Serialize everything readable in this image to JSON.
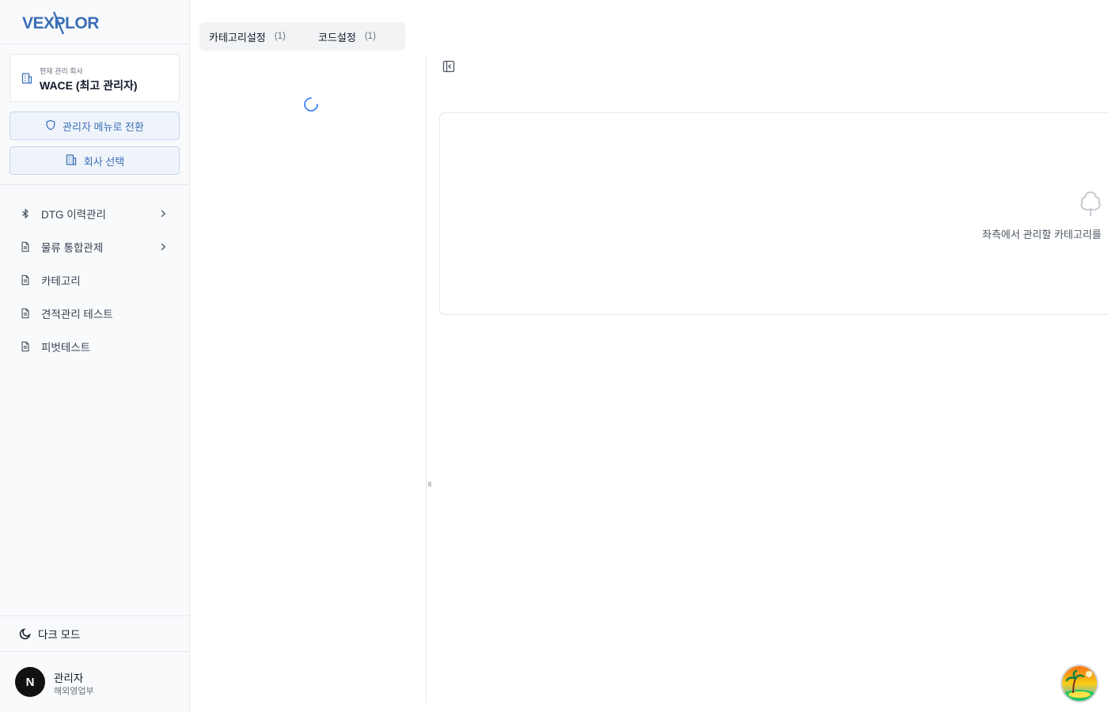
{
  "brand": {
    "logo_text": "VEXPLOR",
    "color": "#3b6fb6"
  },
  "company": {
    "label": "현재 관리 회사",
    "name": "WACE (최고 관리자)"
  },
  "buttons": {
    "admin_switch": "관리자 메뉴로 전환",
    "company_select": "회사 선택"
  },
  "menu": [
    {
      "label": "DTG 이력관리",
      "icon": "bluetooth-icon",
      "has_children": true
    },
    {
      "label": "물류 통합관제",
      "icon": "file-icon",
      "has_children": true
    },
    {
      "label": "카테고리",
      "icon": "file-icon",
      "has_children": false
    },
    {
      "label": "견적관리 테스트",
      "icon": "file-icon",
      "has_children": false
    },
    {
      "label": "피벗테스트",
      "icon": "file-icon",
      "has_children": false
    }
  ],
  "dark_mode": {
    "label": "다크 모드",
    "icon": "moon-icon"
  },
  "user": {
    "avatar_letter": "N",
    "name": "관리자",
    "department": "해외영업부"
  },
  "tabs": [
    {
      "label": "카테고리설정",
      "count": "(1)"
    },
    {
      "label": "코드설정",
      "count": "(1)"
    }
  ],
  "detail": {
    "empty_message": "좌측에서 관리할 카테고리를",
    "icon": "tree-icon"
  },
  "colors": {
    "accent": "#3b6fb6",
    "accent_bg": "#eff4fb",
    "spinner": "#3b82f6"
  }
}
